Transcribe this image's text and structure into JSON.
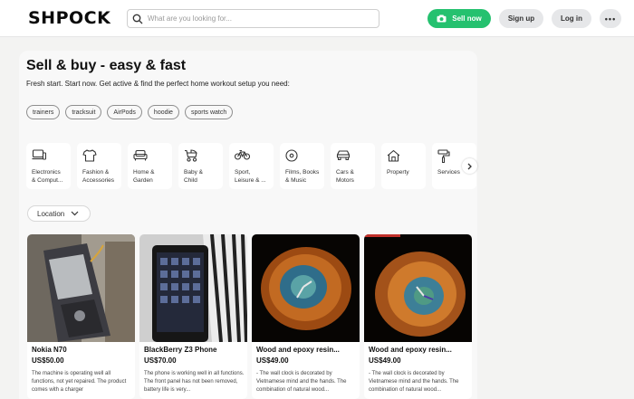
{
  "header": {
    "logo": "SHPOCK",
    "search_placeholder": "What are you looking for...",
    "sell_label": "Sell now",
    "signup_label": "Sign up",
    "login_label": "Log in",
    "more_label": "•••"
  },
  "hero": {
    "title": "Sell & buy - easy & fast",
    "subtitle": "Fresh start. Start now. Get active & find the perfect home workout setup you need:"
  },
  "tags": [
    "trainers",
    "tracksuit",
    "AirPods",
    "hoodie",
    "sports watch"
  ],
  "categories": [
    {
      "label": "Electronics\n& Comput...",
      "icon": "electronics-icon"
    },
    {
      "label": "Fashion &\nAccessories",
      "icon": "tshirt-icon"
    },
    {
      "label": "Home &\nGarden",
      "icon": "sofa-icon"
    },
    {
      "label": "Baby &\nChild",
      "icon": "stroller-icon"
    },
    {
      "label": "Sport,\nLeisure & ...",
      "icon": "bicycle-icon"
    },
    {
      "label": "Films, Books\n& Music",
      "icon": "disc-icon"
    },
    {
      "label": "Cars &\nMotors",
      "icon": "car-icon"
    },
    {
      "label": "Property",
      "icon": "house-icon"
    },
    {
      "label": "Services",
      "icon": "paint-roller-icon"
    }
  ],
  "location_label": "Location",
  "listings": [
    {
      "title": "Nokia N70",
      "price": "US$50.00",
      "desc": "The machine is operating well all functions, not yet repaired. The product comes with a charger"
    },
    {
      "title": "BlackBerry Z3 Phone",
      "price": "US$70.00",
      "desc": "The phone is working well in all functions. The front panel has not been removed, battery life is very..."
    },
    {
      "title": "Wood and epoxy resin...",
      "price": "US$49.00",
      "desc": "- The wall clock is decorated by Vietnamese mind and the hands. The combination of natural wood..."
    },
    {
      "title": "Wood and epoxy resin...",
      "price": "US$49.00",
      "desc": "- The wall clock is decorated by Vietnamese mind and the hands. The combination of natural wood..."
    }
  ],
  "colors": {
    "accent": "#25c16f",
    "button_bg": "#e6e7e9"
  }
}
